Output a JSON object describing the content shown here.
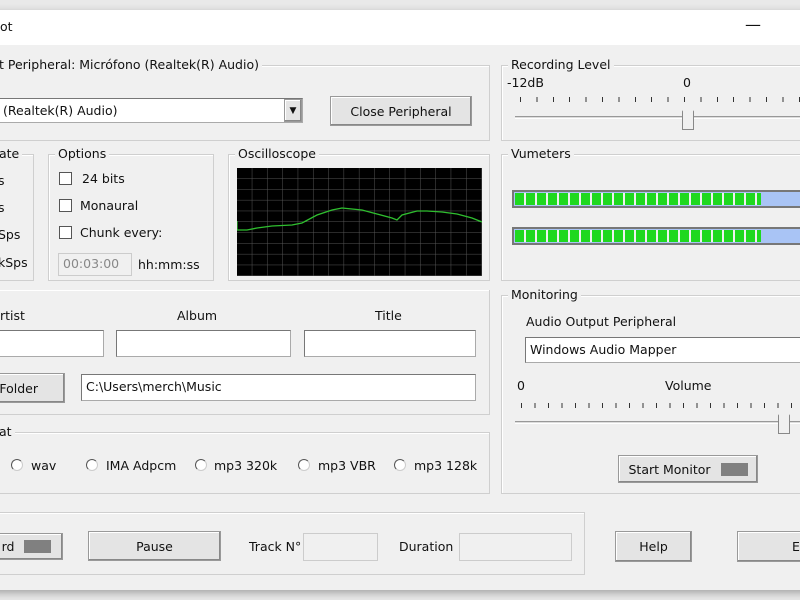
{
  "window": {
    "title": "ot",
    "minimize_glyph": "—"
  },
  "input_peripheral": {
    "legend": "t Peripheral: Micrófono (Realtek(R) Audio)",
    "selected": "(Realtek(R) Audio)",
    "close_label": "Close Peripheral"
  },
  "rate": {
    "legend": "ate",
    "options": [
      "s",
      "s",
      "Sps",
      "kSps"
    ]
  },
  "options": {
    "legend": "Options",
    "bits24": "24 bits",
    "monaural": "Monaural",
    "chunk": "Chunk every:",
    "chunk_value": "00:03:00",
    "chunk_unit": "hh:mm:ss"
  },
  "oscilloscope": {
    "legend": "Oscilloscope",
    "trace_color": "#2fbf2f"
  },
  "recording_level": {
    "legend": "Recording Level",
    "min_label": "-12dB",
    "mid_label": "0"
  },
  "vumeters": {
    "legend": "Vumeters",
    "left_level": 0.8,
    "right_level": 0.8,
    "on_color": "#1fd81f",
    "off_color": "#a9c4f5"
  },
  "metadata": {
    "artist_label": "rtist",
    "album_label": "Album",
    "title_label": "Title",
    "artist": "",
    "album": "",
    "title": "",
    "folder_label": "Folder",
    "folder_path": "C:\\Users\\merch\\Music"
  },
  "format": {
    "legend": "at",
    "options": [
      "wav",
      "IMA Adpcm",
      "mp3 320k",
      "mp3 VBR",
      "mp3 128k"
    ]
  },
  "monitoring": {
    "legend": "Monitoring",
    "output_label": "Audio Output Peripheral",
    "output_value": "Windows Audio Mapper",
    "vol_min": "0",
    "vol_label": "Volume",
    "start_label": "Start Monitor"
  },
  "bottom": {
    "record_label": "rd",
    "pause_label": "Pause",
    "track_label": "Track N°",
    "track_value": "",
    "duration_label": "Duration",
    "duration_value": "",
    "help_label": "Help",
    "exit_label": "E"
  }
}
